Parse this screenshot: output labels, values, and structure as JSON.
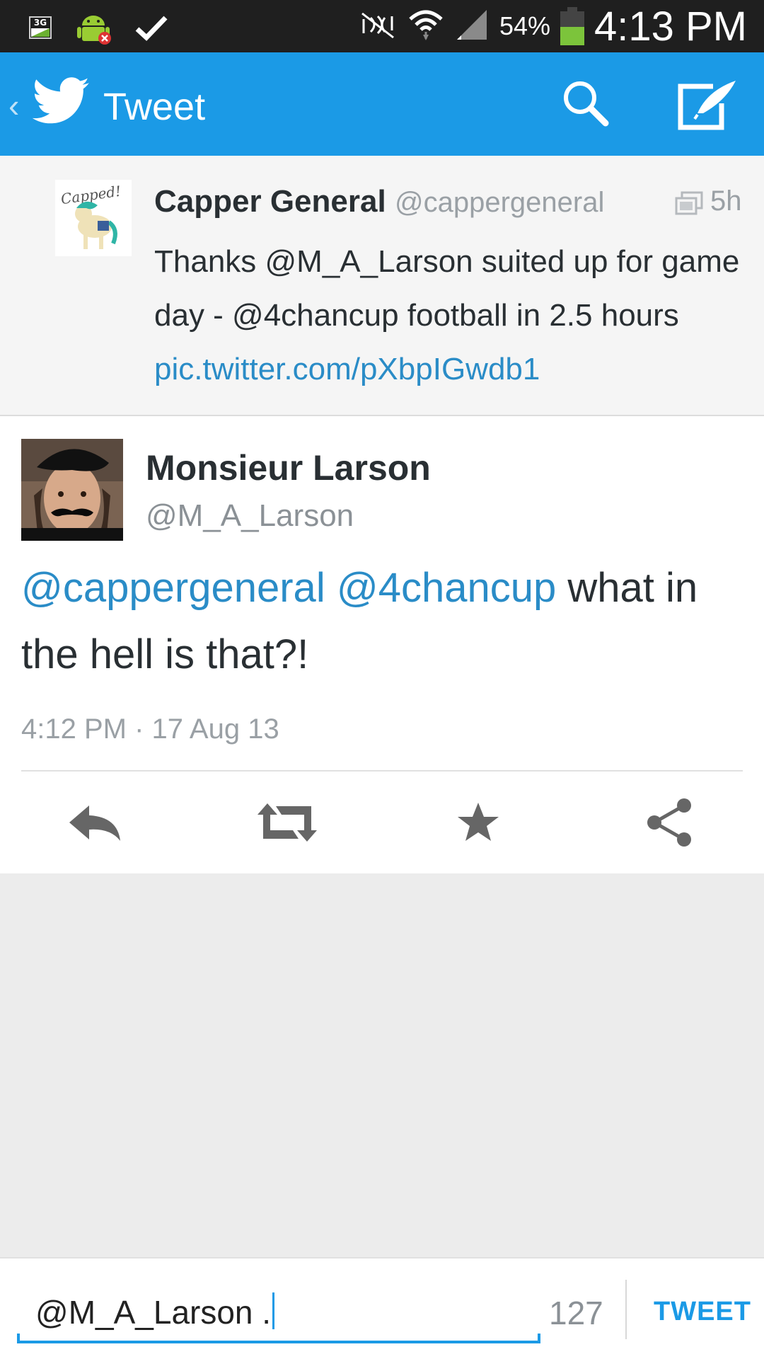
{
  "status_bar": {
    "network_badge": "3G",
    "battery_text": "54%",
    "battery_level": 0.54,
    "time": "4:13 PM"
  },
  "action_bar": {
    "title": "Tweet",
    "icons": [
      "back-chevron-icon",
      "twitter-bird-icon",
      "search-icon",
      "compose-icon"
    ]
  },
  "in_reply_to": {
    "name": "Capper General",
    "handle": "@cappergeneral",
    "time": "5h",
    "text_prefix": "Thanks @M_A_Larson suited up for game day - @4chancup football in 2.5 hours ",
    "link": "pic.twitter.com/pXbpIGwdb1",
    "avatar_caption": "Capped!"
  },
  "tweet": {
    "name": "Monsieur Larson",
    "handle": "@M_A_Larson",
    "mention_1": "@cappergeneral",
    "mention_2": "@4chancup",
    "text_rest": " what in the hell is that?!",
    "timestamp": "4:12 PM · 17 Aug 13",
    "actions": [
      "reply-icon",
      "retweet-icon",
      "favorite-star-icon",
      "share-icon"
    ]
  },
  "compose": {
    "value": "@M_A_Larson .",
    "remaining": "127",
    "submit_label": "TWEET"
  },
  "colors": {
    "brand_blue": "#1b9ae6",
    "link_blue": "#2a8cc7",
    "status_bar": "#1f1f1f",
    "battery_green": "#7cc43b"
  }
}
